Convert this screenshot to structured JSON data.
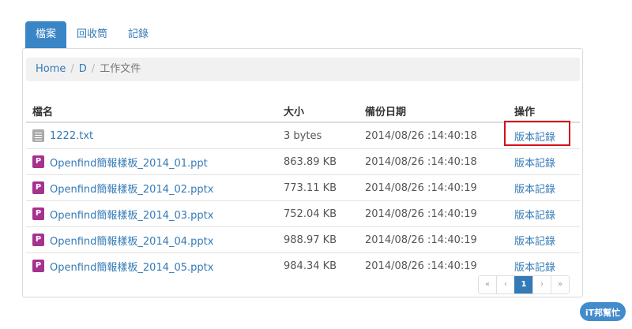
{
  "tabs": [
    {
      "label": "檔案",
      "active": true
    },
    {
      "label": "回收筒",
      "active": false
    },
    {
      "label": "記錄",
      "active": false
    }
  ],
  "breadcrumb": {
    "links": [
      "Home",
      "D"
    ],
    "separator": "/",
    "current": "工作文件"
  },
  "table": {
    "headers": {
      "name": "檔名",
      "size": "大小",
      "date": "備份日期",
      "action": "操作"
    },
    "rows": [
      {
        "icon": "text-file-icon",
        "name": "1222.txt",
        "size": "3 bytes",
        "date": "2014/08/26 :14:40:18",
        "action": "版本記錄",
        "highlighted": true
      },
      {
        "icon": "powerpoint-file-icon",
        "name": "Openfind簡報樣板_2014_01.ppt",
        "size": "863.89 KB",
        "date": "2014/08/26 :14:40:18",
        "action": "版本記錄",
        "highlighted": false
      },
      {
        "icon": "powerpoint-file-icon",
        "name": "Openfind簡報樣板_2014_02.pptx",
        "size": "773.11 KB",
        "date": "2014/08/26 :14:40:19",
        "action": "版本記錄",
        "highlighted": false
      },
      {
        "icon": "powerpoint-file-icon",
        "name": "Openfind簡報樣板_2014_03.pptx",
        "size": "752.04 KB",
        "date": "2014/08/26 :14:40:19",
        "action": "版本記錄",
        "highlighted": false
      },
      {
        "icon": "powerpoint-file-icon",
        "name": "Openfind簡報樣板_2014_04.pptx",
        "size": "988.97 KB",
        "date": "2014/08/26 :14:40:19",
        "action": "版本記錄",
        "highlighted": false
      },
      {
        "icon": "powerpoint-file-icon",
        "name": "Openfind簡報樣板_2014_05.pptx",
        "size": "984.34 KB",
        "date": "2014/08/26 :14:40:19",
        "action": "版本記錄",
        "highlighted": false
      }
    ]
  },
  "pagination": {
    "first": "«",
    "prev": "‹",
    "current": "1",
    "next": "›",
    "last": "»"
  },
  "watermark": {
    "logo_text": "iT邦幫忙"
  },
  "colors": {
    "accent": "#337ab7",
    "active_tab": "#3a85c6",
    "highlight_box": "#d4101a",
    "ppt_icon": "#a5328f",
    "txt_icon": "#a9a9a9"
  }
}
